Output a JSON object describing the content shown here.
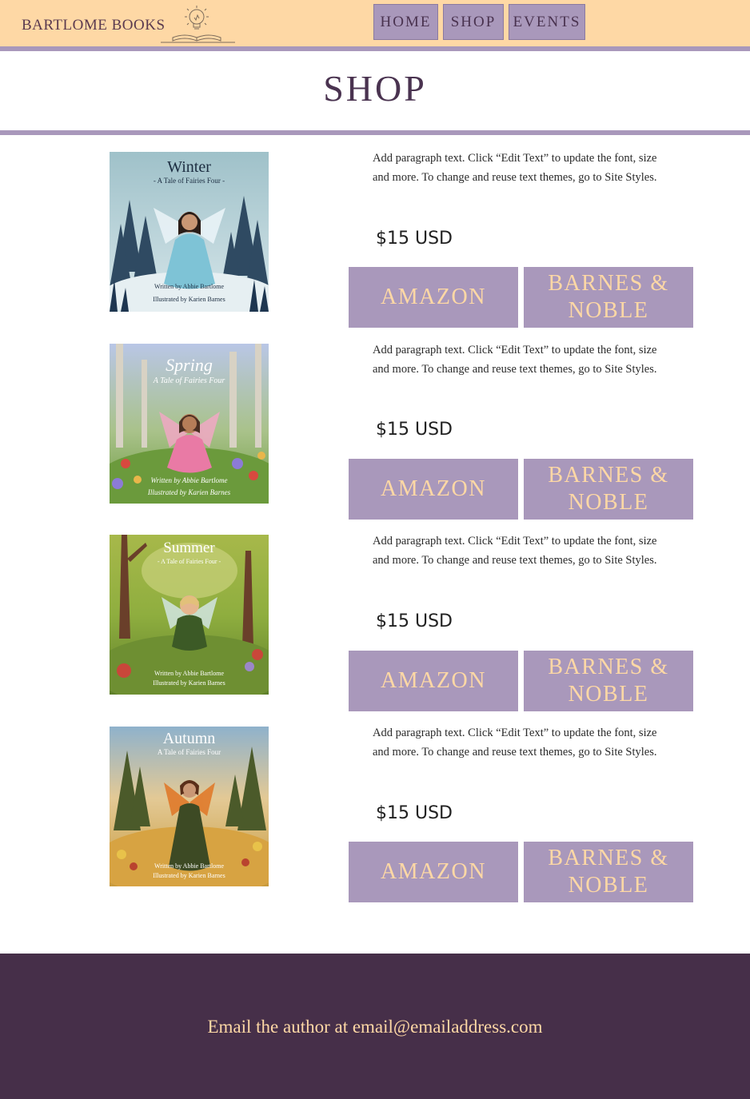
{
  "header": {
    "brand": "BARTLOME BOOKS",
    "nav": [
      "HOME",
      "SHOP",
      "EVENTS"
    ]
  },
  "page_title": "SHOP",
  "products": [
    {
      "cover_title": "Winter",
      "cover_subtitle": "- A Tale of Fairies Four -",
      "cover_credit_1": "Written by Abbie Bartlome",
      "cover_credit_2": "Illustrated by Karien Barnes",
      "description": "Add paragraph text. Click “Edit Text” to update the font, size and more. To change and reuse text themes, go to Site Styles.",
      "price": "$15 USD",
      "amazon_label": "AMAZON",
      "bn_label": "BARNES & NOBLE"
    },
    {
      "cover_title": "Spring",
      "cover_subtitle": "A Tale of Fairies Four",
      "cover_credit_1": "Written by Abbie Bartlome",
      "cover_credit_2": "Illustrated by Karien Barnes",
      "description": "Add paragraph text. Click “Edit Text” to update the font, size and more. To change and reuse text themes, go to Site Styles.",
      "price": "$15 USD",
      "amazon_label": "AMAZON",
      "bn_label": "BARNES & NOBLE"
    },
    {
      "cover_title": "Summer",
      "cover_subtitle": "- A Tale of Fairies Four -",
      "cover_credit_1": "Written by Abbie Bartlome",
      "cover_credit_2": "Illustrated by Karien Barnes",
      "description": "Add paragraph text. Click “Edit Text” to update the font, size and more. To change and reuse text themes, go to Site Styles.",
      "price": "$15 USD",
      "amazon_label": "AMAZON",
      "bn_label": "BARNES & NOBLE"
    },
    {
      "cover_title": "Autumn",
      "cover_subtitle": "A Tale of Fairies Four",
      "cover_credit_1": "Written by Abbie Bartlome",
      "cover_credit_2": "Illustrated by Karien Barnes",
      "description": "Add paragraph text. Click “Edit Text” to update the font, size and more. To change and reuse text themes, go to Site Styles.",
      "price": "$15 USD",
      "amazon_label": "AMAZON",
      "bn_label": "BARNES & NOBLE"
    }
  ],
  "footer": {
    "text": "Email the author at email@emailaddress.com"
  },
  "colors": {
    "header_bg": "#fed8a5",
    "accent_purple": "#a998bb",
    "footer_bg": "#462f49",
    "button_text": "#fed8a5"
  }
}
